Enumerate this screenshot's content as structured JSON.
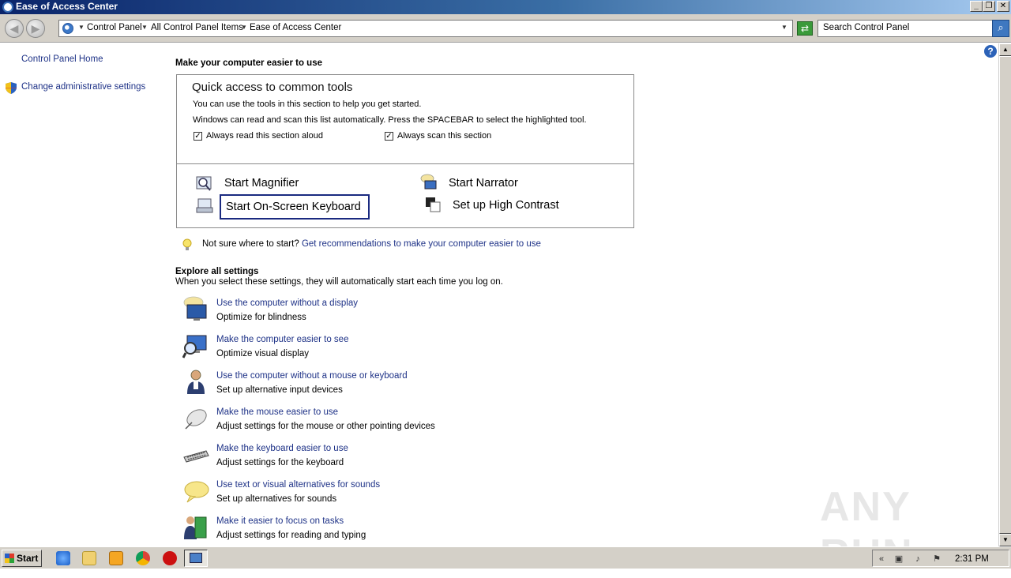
{
  "window": {
    "title": "Ease of Access Center",
    "buttons": {
      "minimize": "_",
      "maximize": "❐",
      "close": "✕"
    }
  },
  "address_bar": {
    "back_glyph": "◀",
    "forward_glyph": "▶",
    "breadcrumbs": [
      "Control Panel",
      "All Control Panel Items",
      "Ease of Access Center"
    ],
    "search_placeholder": "Search Control Panel"
  },
  "left_pane": {
    "home_link": "Control Panel Home",
    "admin_link": "Change administrative settings"
  },
  "main": {
    "heading": "Make your computer easier to use",
    "quick_access": {
      "title": "Quick access to common tools",
      "line1": "You can use the tools in this section to help you get started.",
      "line2": "Windows can read and scan this list automatically.  Press the SPACEBAR to select the highlighted tool.",
      "checkbox_read": {
        "label": "Always read this section aloud",
        "checked": true
      },
      "checkbox_scan": {
        "label": "Always scan this section",
        "checked": true
      },
      "tools": {
        "magnifier": "Start Magnifier",
        "narrator": "Start Narrator",
        "keyboard": "Start On-Screen Keyboard",
        "contrast": "Set up High Contrast"
      }
    },
    "tip": {
      "prefix": "Not sure where to start?",
      "link": "Get recommendations to make your computer easier to use"
    },
    "explore": {
      "heading": "Explore all settings",
      "subheading": "When you select these settings, they will automatically start each time you log on.",
      "items": [
        {
          "link": "Use the computer without a display",
          "sub": "Optimize for blindness",
          "icon": "monitor-speaker-icon"
        },
        {
          "link": "Make the computer easier to see",
          "sub": "Optimize visual display",
          "icon": "monitor-magnifier-icon"
        },
        {
          "link": "Use the computer without a mouse or keyboard",
          "sub": "Set up alternative input devices",
          "icon": "person-icon"
        },
        {
          "link": "Make the mouse easier to use",
          "sub": "Adjust settings for the mouse or other pointing devices",
          "icon": "mouse-icon"
        },
        {
          "link": "Make the keyboard easier to use",
          "sub": "Adjust settings for the keyboard",
          "icon": "keyboard-icon"
        },
        {
          "link": "Use text or visual alternatives for sounds",
          "sub": "Set up alternatives for sounds",
          "icon": "speech-bubble-icon"
        },
        {
          "link": "Make it easier to focus on tasks",
          "sub": "Adjust settings for reading and typing",
          "icon": "person-book-icon"
        }
      ]
    }
  },
  "help_glyph": "?",
  "watermark": "ANY RUN",
  "taskbar": {
    "start_label": "Start",
    "clock": "2:31 PM",
    "tray_expand": "«"
  },
  "colors": {
    "link": "#1e3287",
    "titlebar_start": "#0a246a",
    "chrome": "#d4d0c8"
  }
}
